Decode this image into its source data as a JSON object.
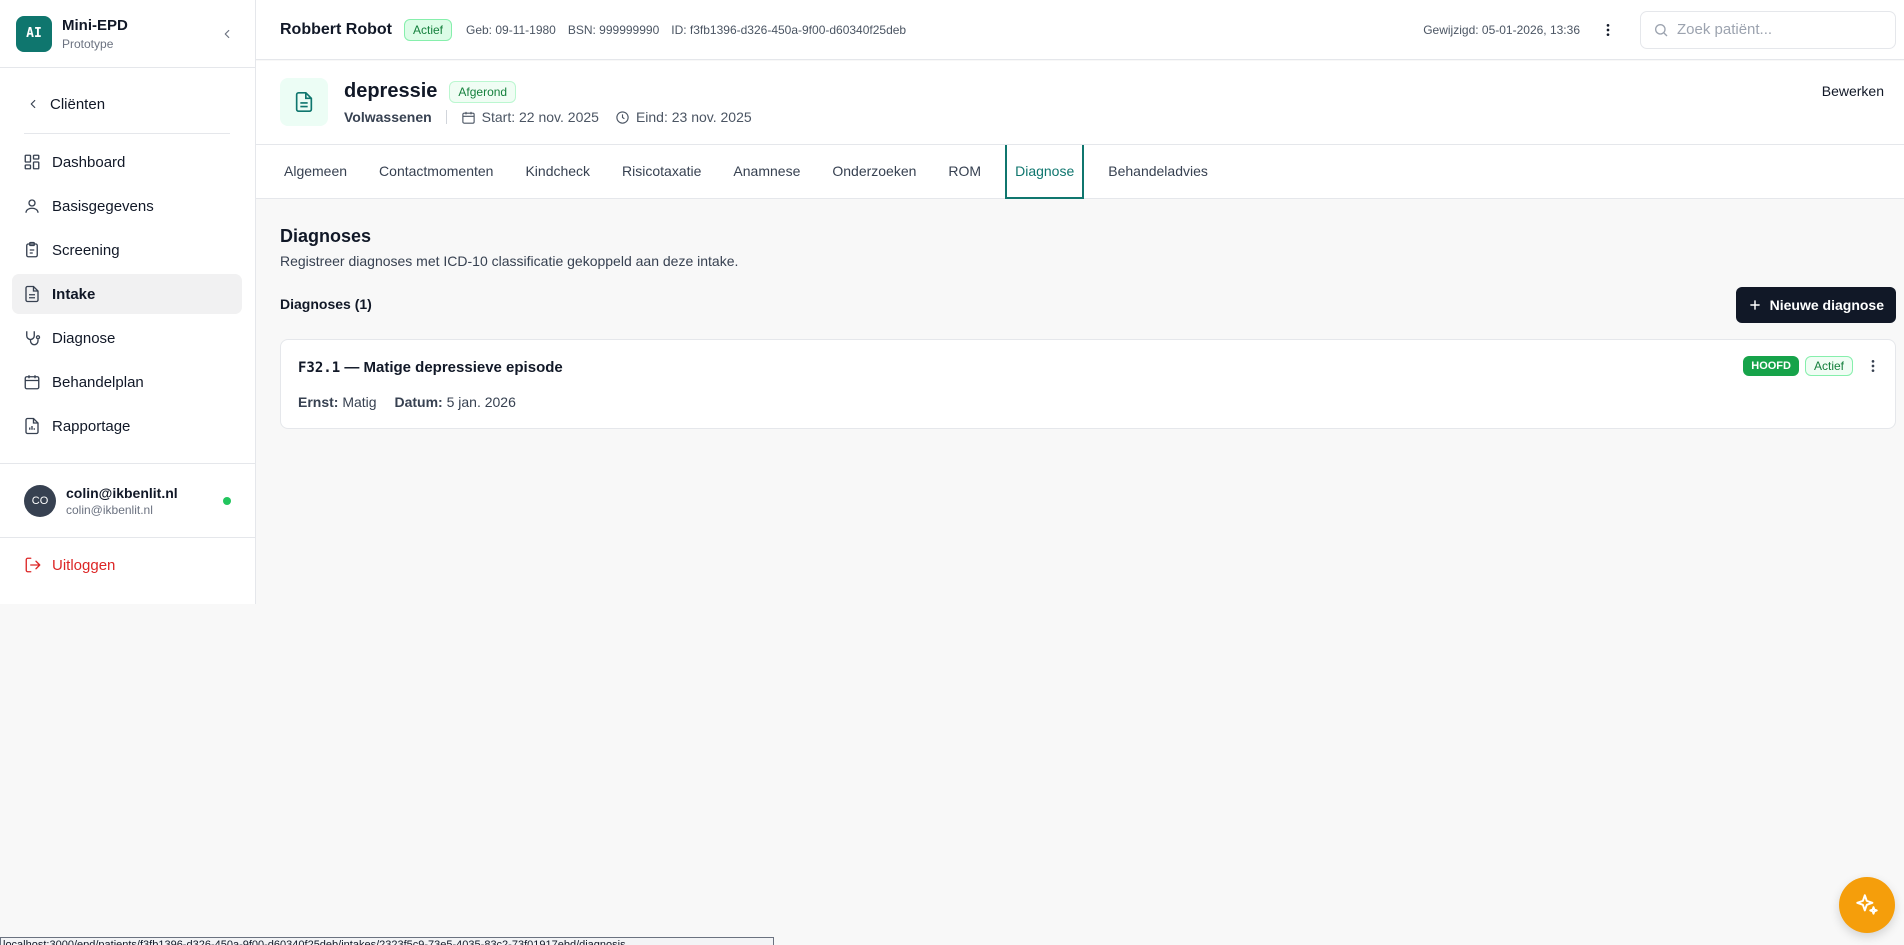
{
  "app": {
    "logo": "AI",
    "title": "Mini-EPD",
    "subtitle": "Prototype"
  },
  "sidebar": {
    "back_label": "Cliënten",
    "items": [
      {
        "label": "Dashboard",
        "icon": "dashboard-icon"
      },
      {
        "label": "Basisgegevens",
        "icon": "user-icon"
      },
      {
        "label": "Screening",
        "icon": "clipboard-icon"
      },
      {
        "label": "Intake",
        "icon": "document-icon",
        "active": true
      },
      {
        "label": "Diagnose",
        "icon": "stethoscope-icon"
      },
      {
        "label": "Behandelplan",
        "icon": "calendar-icon"
      },
      {
        "label": "Rapportage",
        "icon": "report-icon"
      }
    ],
    "user": {
      "initials": "CO",
      "name": "colin@ikbenlit.nl",
      "email": "colin@ikbenlit.nl",
      "status_color": "#22c55e"
    },
    "logout_label": "Uitloggen"
  },
  "topbar": {
    "patient_name": "Robbert Robot",
    "status": "Actief",
    "birth": "Geb: 09-11-1980",
    "bsn": "BSN: 999999990",
    "id": "ID: f3fb1396-d326-450a-9f00-d60340f25deb",
    "modified": "Gewijzigd: 05-01-2026, 13:36",
    "search_placeholder": "Zoek patiënt..."
  },
  "intake": {
    "title": "depressie",
    "status": "Afgerond",
    "group": "Volwassenen",
    "start": "Start: 22 nov. 2025",
    "end": "Eind: 23 nov. 2025",
    "edit_label": "Bewerken"
  },
  "tabs": [
    {
      "label": "Algemeen"
    },
    {
      "label": "Contactmomenten"
    },
    {
      "label": "Kindcheck"
    },
    {
      "label": "Risicotaxatie"
    },
    {
      "label": "Anamnese"
    },
    {
      "label": "Onderzoeken"
    },
    {
      "label": "ROM"
    },
    {
      "label": "Diagnose",
      "active": true
    },
    {
      "label": "Behandeladvies"
    }
  ],
  "main": {
    "title": "Diagnoses",
    "subtitle": "Registreer diagnoses met ICD-10 classificatie gekoppeld aan deze intake.",
    "count_label": "Diagnoses (1)",
    "new_button": "Nieuwe diagnose",
    "diagnoses": [
      {
        "code": "F32.1",
        "title": " — Matige depressieve episode",
        "severity_label": "Ernst:",
        "severity": "Matig",
        "date_label": "Datum:",
        "date": "5 jan. 2026",
        "badge_main": "HOOFD",
        "badge_status": "Actief"
      }
    ]
  },
  "statusbar": {
    "text": "localhost:3000/epd/patients/f3fb1396-d326-450a-9f00-d60340f25deb/intakes/2323f5c9-73e5-4035-83c2-73f01917ebd/diagnosis"
  },
  "colors": {
    "accent": "#0f766e",
    "primary_button": "#111827",
    "fab": "#f59e0b",
    "logout": "#dc2626"
  }
}
